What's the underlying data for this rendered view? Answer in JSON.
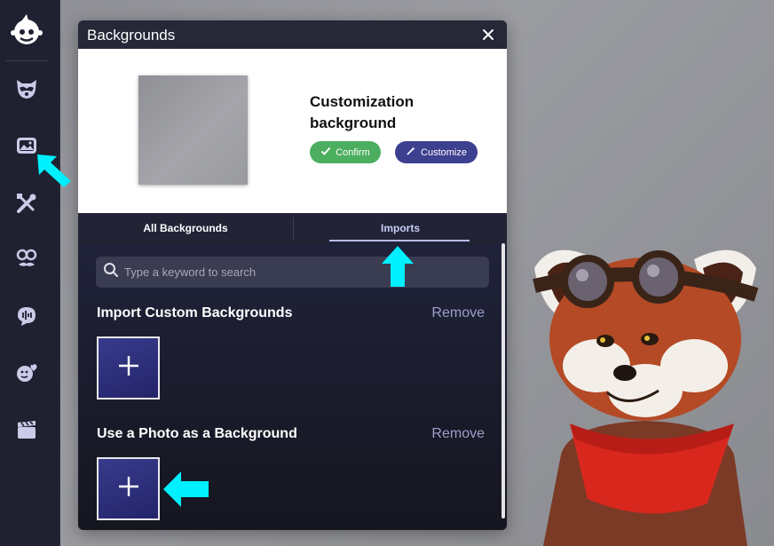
{
  "sidebar": {
    "items": [
      {
        "icon": "raccoon-face-icon"
      },
      {
        "icon": "background-image-icon"
      },
      {
        "icon": "tools-icon"
      },
      {
        "icon": "face-props-icon"
      },
      {
        "icon": "voice-chat-icon"
      },
      {
        "icon": "emoji-heart-icon"
      },
      {
        "icon": "clapperboard-icon"
      }
    ]
  },
  "panel": {
    "title": "Backgrounds",
    "preview": {
      "title": "Customization background",
      "confirm_label": "Confirm",
      "customize_label": "Customize"
    },
    "tabs": [
      {
        "label": "All Backgrounds",
        "active": false
      },
      {
        "label": "Imports",
        "active": true
      }
    ],
    "search": {
      "placeholder": "Type a keyword to search",
      "value": ""
    },
    "sections": [
      {
        "title": "Import Custom Backgrounds",
        "remove_label": "Remove"
      },
      {
        "title": "Use a Photo as a Background",
        "remove_label": "Remove"
      }
    ]
  },
  "colors": {
    "sidebar_bg": "#1f2130",
    "accent_cyan": "#00f0ff",
    "confirm_green": "#4cae5f",
    "customize_blue": "#3d3f8f",
    "tab_active_text": "#c9cbf5"
  }
}
